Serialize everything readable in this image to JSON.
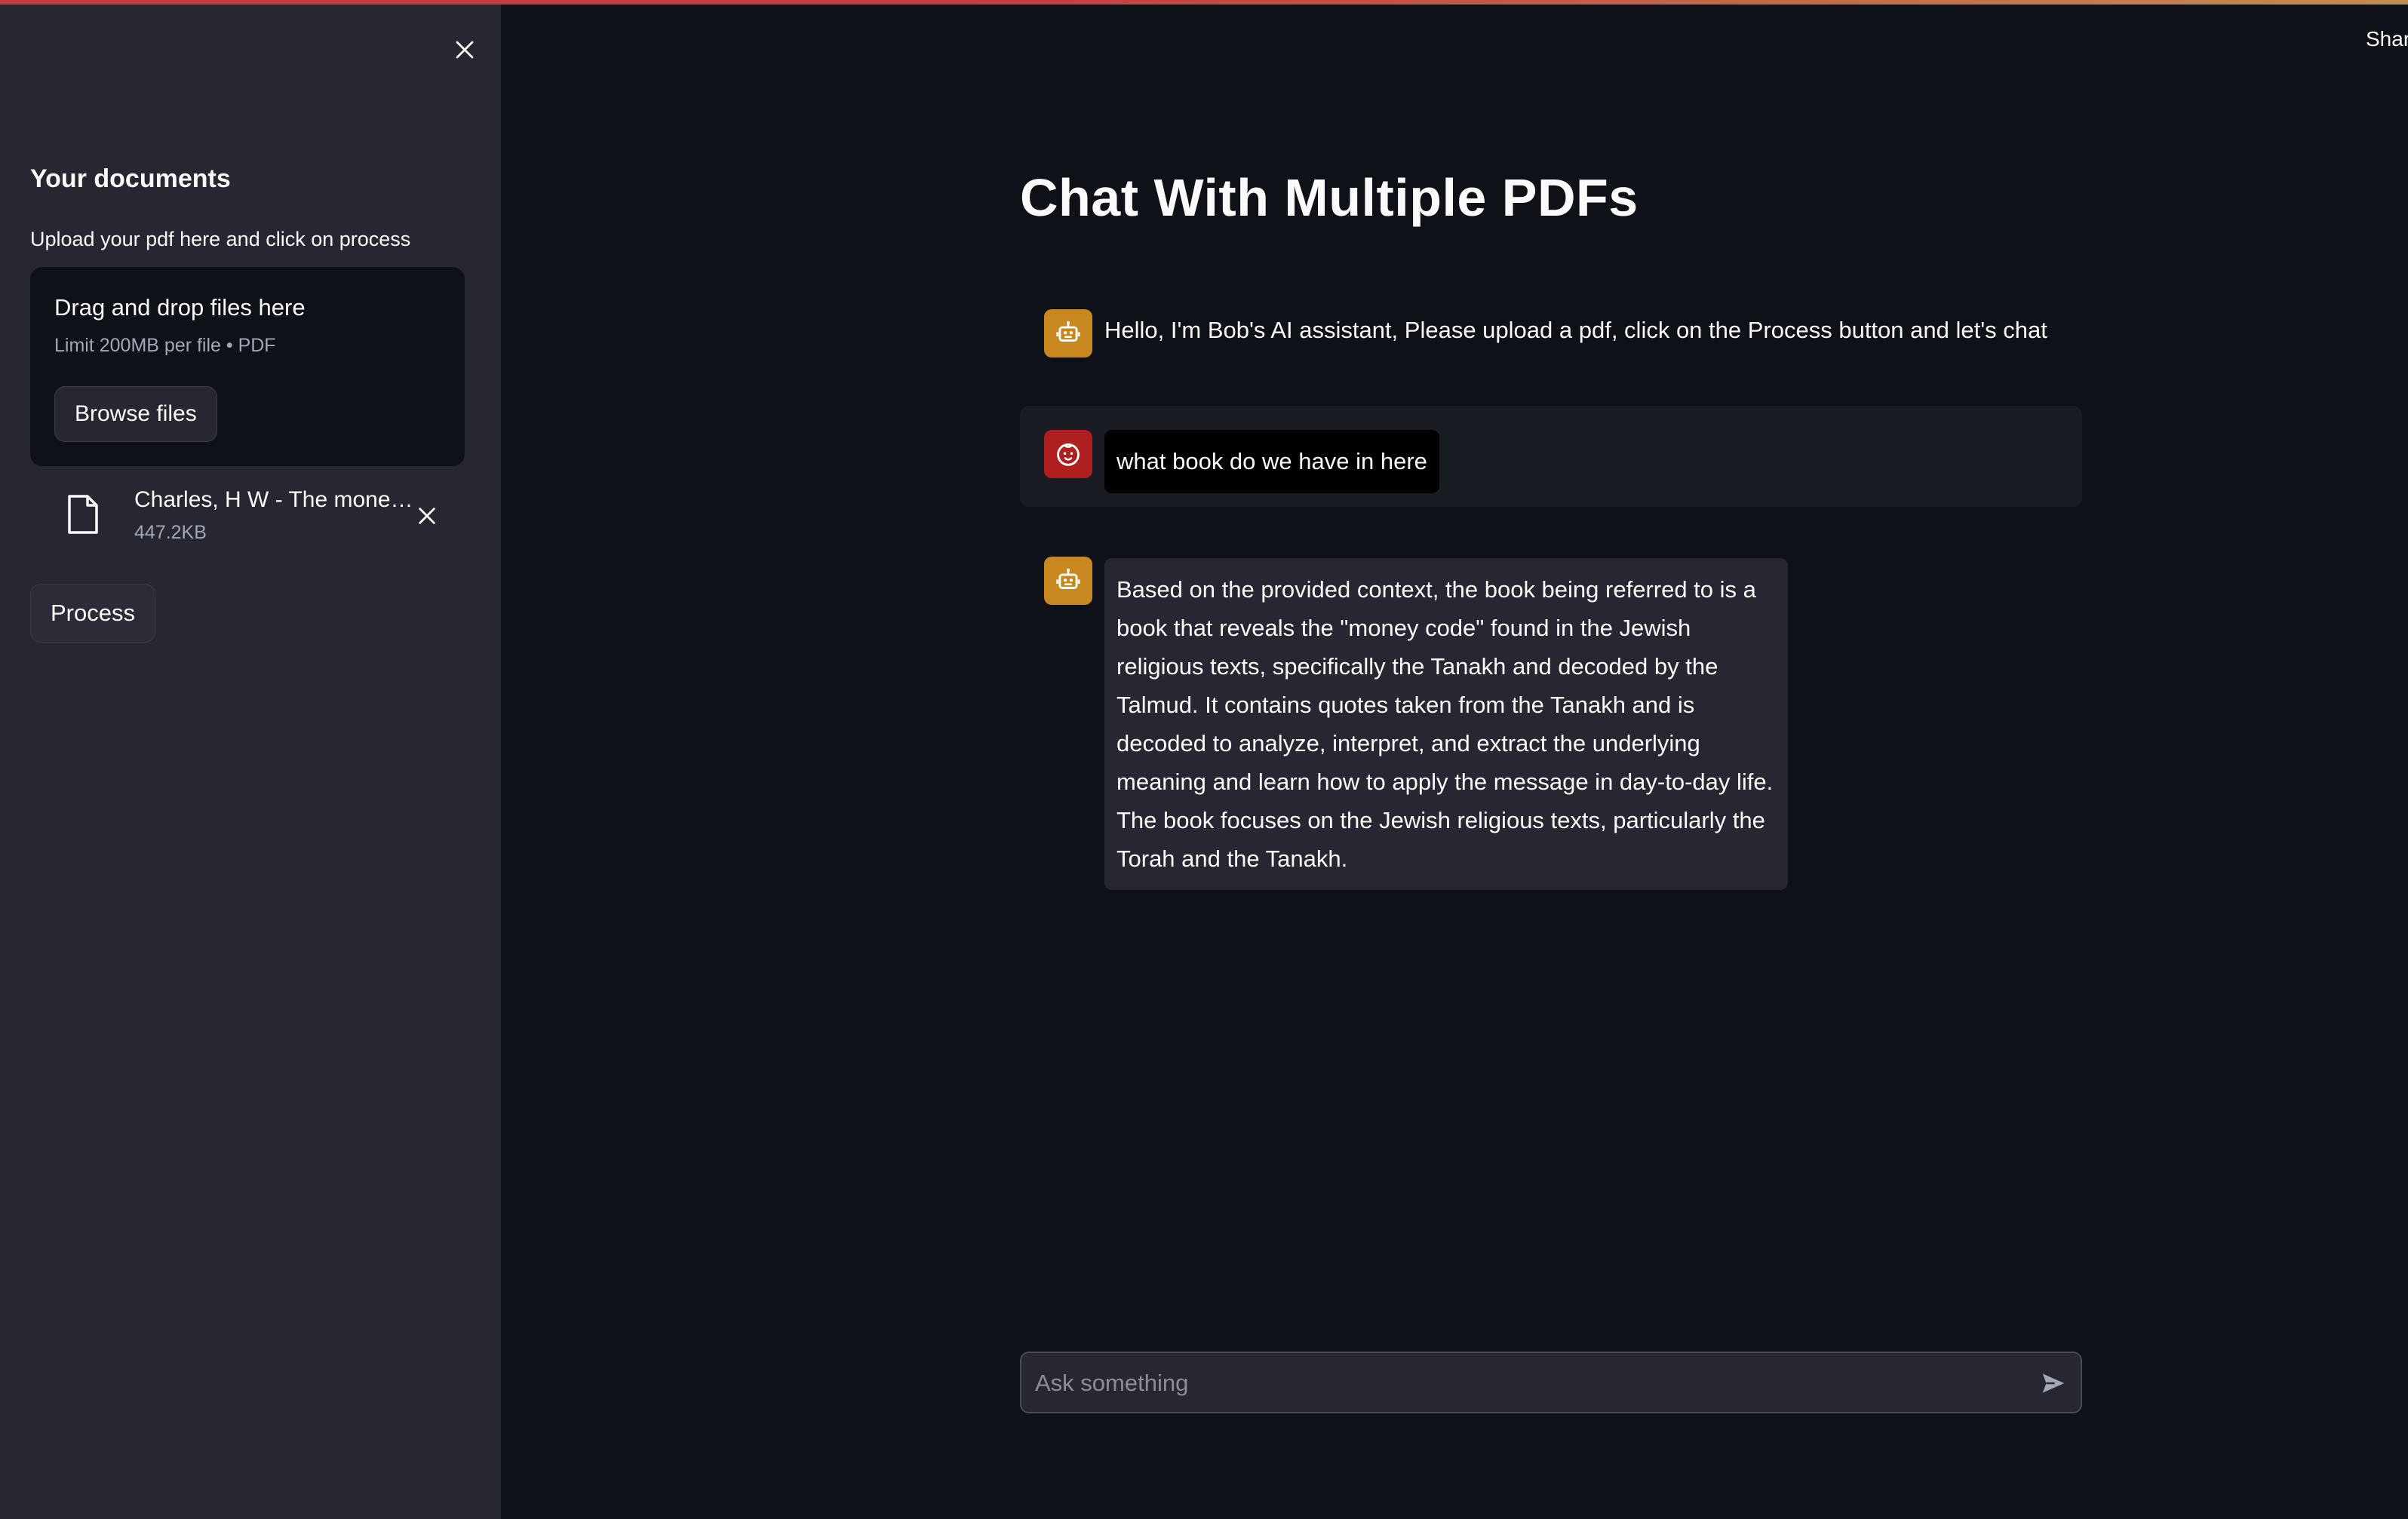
{
  "header": {
    "share_label": "Shar"
  },
  "sidebar": {
    "heading": "Your documents",
    "caption": "Upload your pdf here and click on process",
    "dropzone": {
      "title": "Drag and drop files here",
      "limit": "Limit 200MB per file • PDF",
      "browse_label": "Browse files"
    },
    "file": {
      "name": "Charles, H W - The mone…",
      "size": "447.2KB"
    },
    "process_label": "Process"
  },
  "main": {
    "title": "Chat With Multiple PDFs",
    "messages": [
      {
        "role": "assistant",
        "avatar_icon": "robot-icon",
        "text": "Hello, I'm Bob's AI assistant, Please upload a pdf, click on the Process button and let's chat"
      },
      {
        "role": "user",
        "avatar_icon": "baby-face-icon",
        "text": "what book do we have in here"
      },
      {
        "role": "assistant",
        "avatar_icon": "robot-icon",
        "text": "Based on the provided context, the book being referred to is a book that reveals the \"money code\" found in the Jewish religious texts, specifically the Tanakh and decoded by the Talmud. It contains quotes taken from the Tanakh and is decoded to analyze, interpret, and extract the underlying meaning and learn how to apply the message in day-to-day life. The book focuses on the Jewish religious texts, particularly the Torah and the Tanakh."
      }
    ],
    "chat_input": {
      "placeholder": "Ask something",
      "value": ""
    }
  },
  "colors": {
    "background": "#0e1117",
    "sidebar": "#262730",
    "assistant_avatar": "#c8871f",
    "user_avatar": "#b01f1f"
  }
}
